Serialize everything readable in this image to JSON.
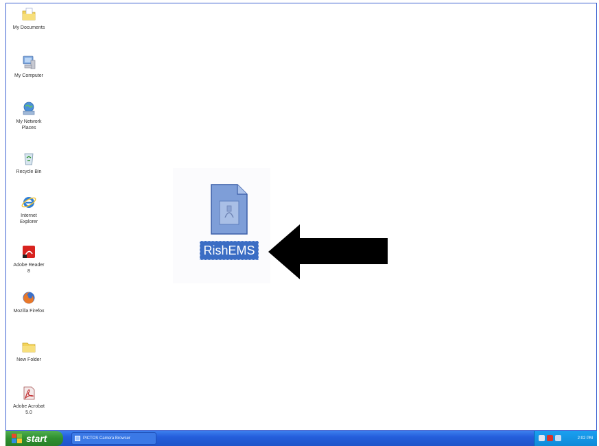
{
  "desktop": {
    "icons": [
      {
        "label": "My Documents",
        "icon": "folder-documents-icon"
      },
      {
        "label": "My Computer",
        "icon": "computer-icon"
      },
      {
        "label": "My Network\nPlaces",
        "icon": "network-places-icon"
      },
      {
        "label": "Recycle Bin",
        "icon": "recycle-bin-icon"
      },
      {
        "label": "Internet\nExplorer",
        "icon": "internet-explorer-icon"
      },
      {
        "label": "Adobe Reader\n8",
        "icon": "adobe-reader-icon"
      },
      {
        "label": "Mozilla Firefox",
        "icon": "firefox-icon"
      },
      {
        "label": "New Folder",
        "icon": "folder-icon"
      },
      {
        "label": "Adobe Acrobat\n5.0",
        "icon": "adobe-acrobat-icon"
      }
    ],
    "selected_icon": {
      "label": "RishEMS",
      "icon": "document-file-icon"
    }
  },
  "taskbar": {
    "start_label": "start",
    "task_item_label": "PICTOS Camera Browser",
    "clock": "2:02 PM"
  },
  "colors": {
    "selection": "#3b6dc4",
    "taskbar_blue": "#245edb",
    "start_green": "#2f8f2f",
    "tray_blue": "#0f8ad8",
    "frame_blue": "#3a5fd0"
  }
}
